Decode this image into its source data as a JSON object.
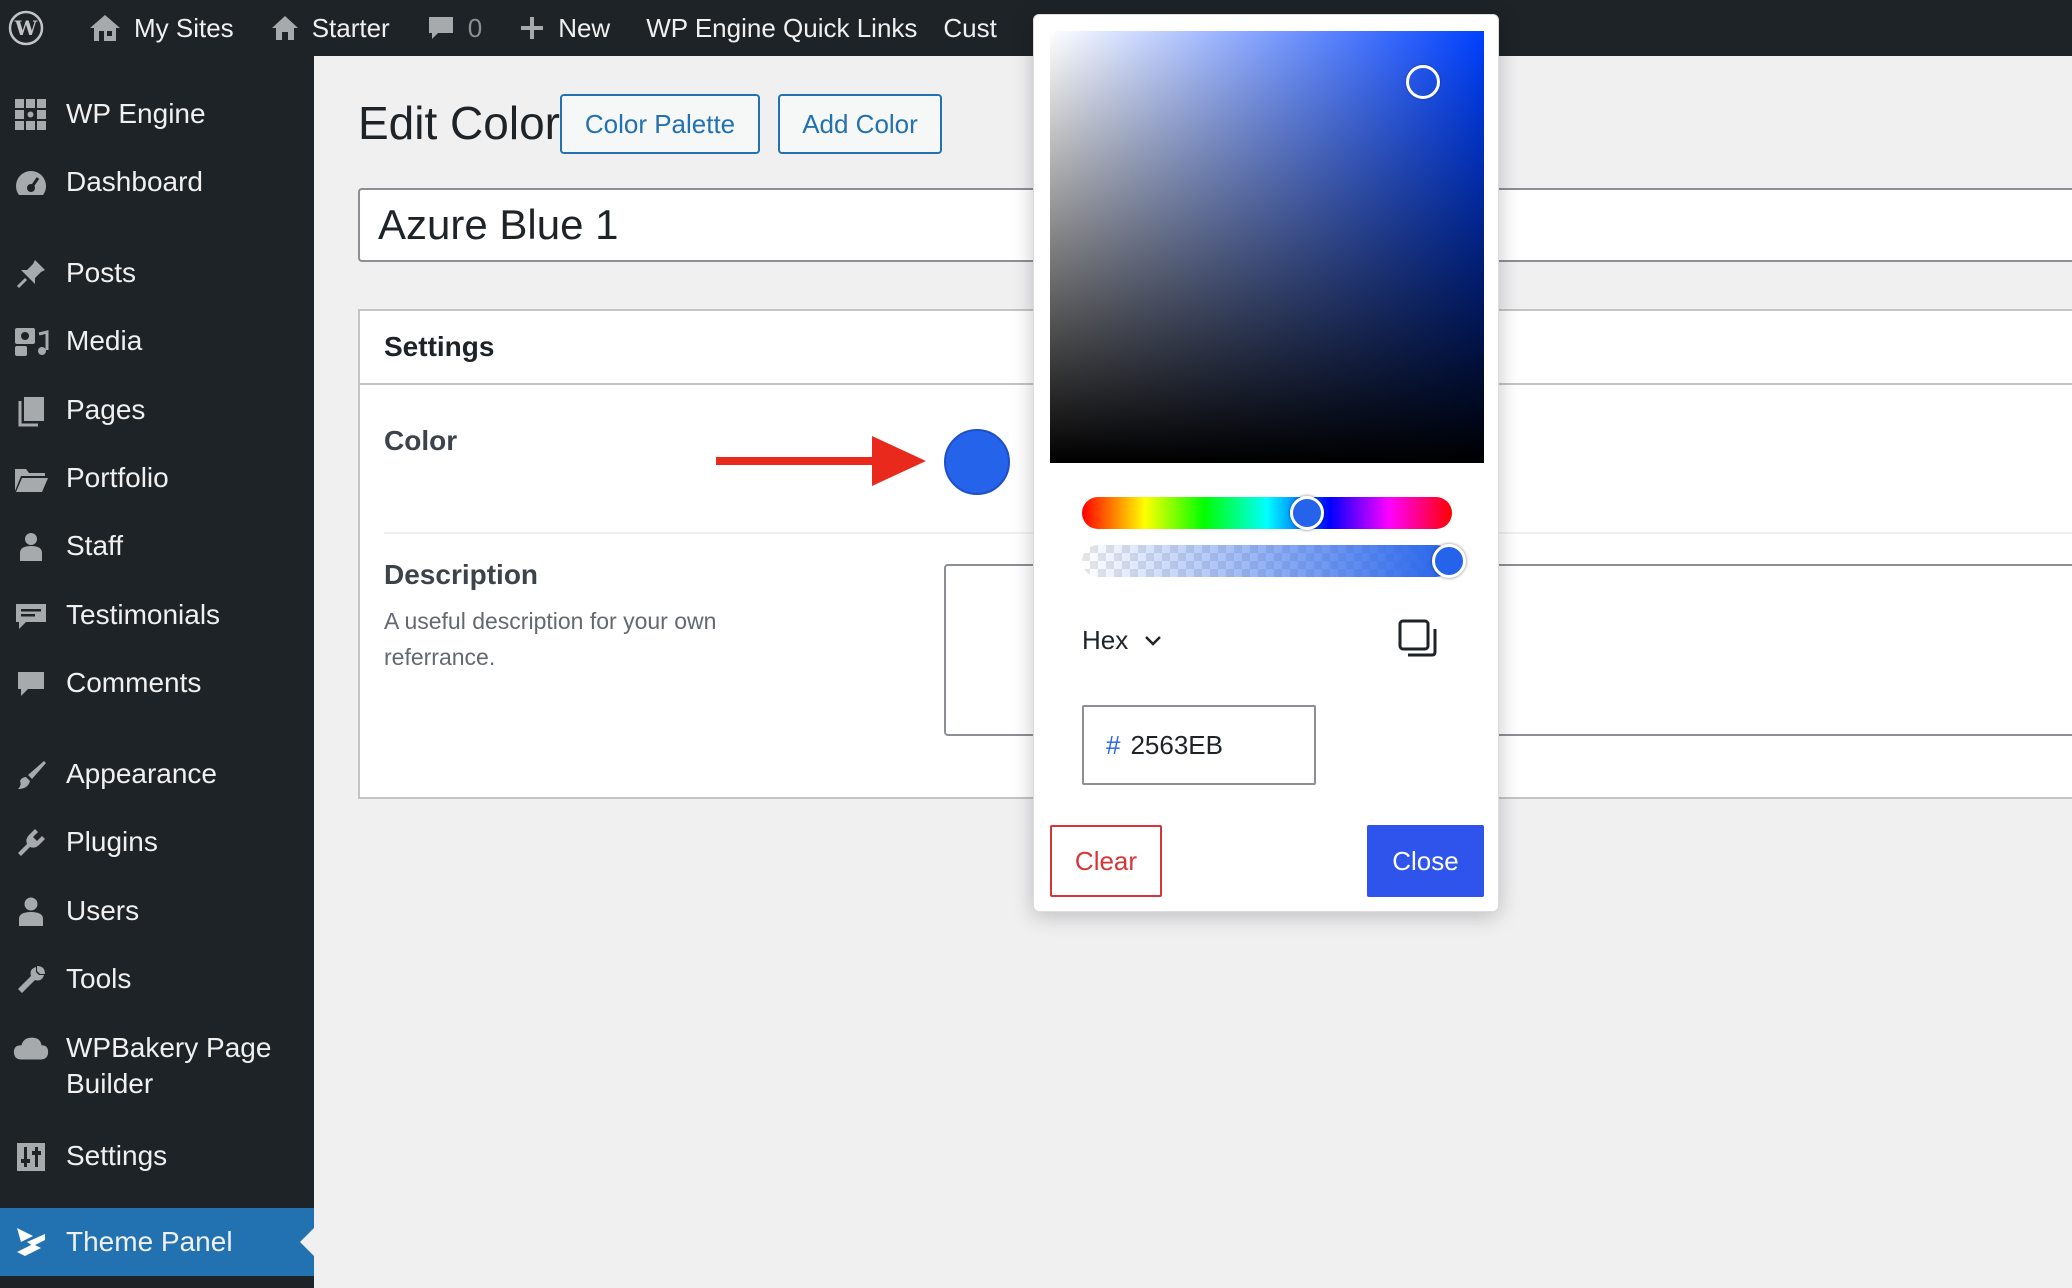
{
  "admin_bar": {
    "my_sites": "My Sites",
    "site_name": "Starter",
    "comment_count": "0",
    "new_label": "New",
    "quick_links": "WP Engine Quick Links",
    "customize_partial": "Cust"
  },
  "sidebar": {
    "items": [
      {
        "label": "WP Engine",
        "icon": "wp-engine-icon"
      },
      {
        "label": "Dashboard",
        "icon": "dashboard-icon"
      },
      {
        "label": "Posts",
        "icon": "pin-icon"
      },
      {
        "label": "Media",
        "icon": "media-icon"
      },
      {
        "label": "Pages",
        "icon": "pages-icon"
      },
      {
        "label": "Portfolio",
        "icon": "folder-icon"
      },
      {
        "label": "Staff",
        "icon": "person-icon"
      },
      {
        "label": "Testimonials",
        "icon": "testimonial-icon"
      },
      {
        "label": "Comments",
        "icon": "comment-icon"
      },
      {
        "label": "Appearance",
        "icon": "brush-icon"
      },
      {
        "label": "Plugins",
        "icon": "plug-icon"
      },
      {
        "label": "Users",
        "icon": "users-icon"
      },
      {
        "label": "Tools",
        "icon": "wrench-icon"
      },
      {
        "label": "WPBakery Page Builder",
        "icon": "cloud-icon"
      },
      {
        "label": "Settings",
        "icon": "sliders-icon"
      },
      {
        "label": "Theme Panel",
        "icon": "theme-panel-icon",
        "current": true
      }
    ]
  },
  "page": {
    "title": "Edit Color",
    "color_palette_button": "Color Palette",
    "add_color_button": "Add Color",
    "post_title_value": "Azure Blue 1"
  },
  "settings": {
    "heading": "Settings",
    "color_label": "Color",
    "color_value": "#2563eb",
    "description_label": "Description",
    "description_help": "A useful description for your own referrance."
  },
  "picker": {
    "format_label": "Hex",
    "hash": "#",
    "hex_value": "2563EB",
    "clear_button": "Clear",
    "close_button": "Close",
    "hue_fraction": 0.63,
    "alpha_fraction": 1.0
  },
  "colors": {
    "admin_dark": "#1d2327",
    "accent_blue": "#2271b1",
    "picked_color": "#2563eb",
    "close_button_bg": "#2f54eb",
    "clear_red": "#d63638",
    "arrow_red": "#e8291c"
  }
}
